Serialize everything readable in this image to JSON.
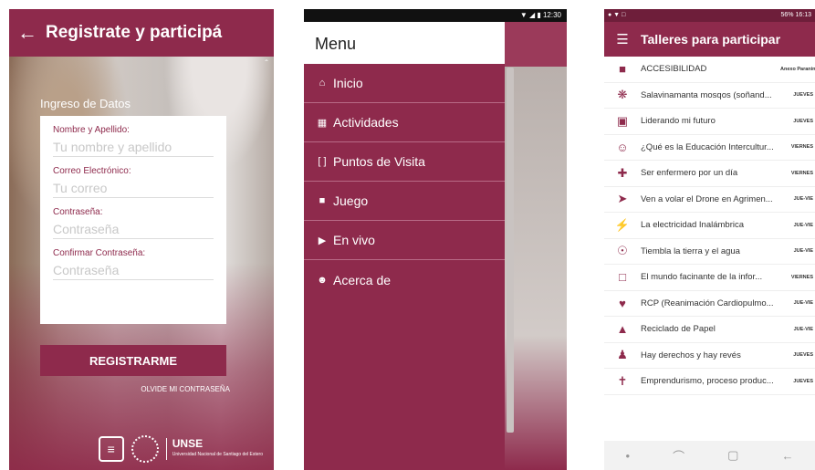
{
  "screen1": {
    "back_icon": "arrow-left-icon",
    "title": "Registrate y participá",
    "section_title": "Ingreso de Datos",
    "fields": [
      {
        "label": "Nombre y Apellido:",
        "placeholder": "Tu nombre y apellido"
      },
      {
        "label": "Correo Electrónico:",
        "placeholder": "Tu correo"
      },
      {
        "label": "Contraseña:",
        "placeholder": "Contraseña"
      },
      {
        "label": "Confirmar Contraseña:",
        "placeholder": "Contraseña"
      }
    ],
    "register_button": "REGISTRARME",
    "forgot_link": "OLVIDE MI CONTRASEÑA",
    "logos": {
      "unse": "UNSE",
      "unse_sub": "Universidad Nacional de Santiago del Estero"
    }
  },
  "screen2": {
    "status_time": "12:30",
    "menu_title": "Menu",
    "items": [
      {
        "label": "Inicio",
        "icon": "home-icon"
      },
      {
        "label": "Actividades",
        "icon": "calendar-icon"
      },
      {
        "label": "Puntos de Visita",
        "icon": "qr-scan-icon"
      },
      {
        "label": "Juego",
        "icon": "gamepad-icon"
      },
      {
        "label": "En vivo",
        "icon": "video-camera-icon"
      },
      {
        "label": "Acerca de",
        "icon": "group-icon"
      }
    ]
  },
  "screen3": {
    "status_right": "56% 16:13",
    "title": "Talleres para participar",
    "menu_icon": "hamburger-icon",
    "items": [
      {
        "name": "ACCESIBILIDAD",
        "day": "Anexo Paraninfo",
        "icon": "video-camera-icon"
      },
      {
        "name": "Salavinamanta mosqos (soñand...",
        "day": "JUEVES",
        "icon": "cog-circle-icon"
      },
      {
        "name": "Liderando mi futuro",
        "day": "JUEVES",
        "icon": "briefcase-icon"
      },
      {
        "name": "¿Qué es la Educación Intercultur...",
        "day": "VIERNES",
        "icon": "smile-icon"
      },
      {
        "name": "Ser enfermero por un día",
        "day": "VIERNES",
        "icon": "medkit-icon"
      },
      {
        "name": "Ven a volar el Drone en Agrimen...",
        "day": "JUE-VIE",
        "icon": "paper-plane-icon"
      },
      {
        "name": "La electricidad Inalámbrica",
        "day": "JUE-VIE",
        "icon": "lightning-icon"
      },
      {
        "name": "Tiembla la tierra y el agua",
        "day": "JUE-VIE",
        "icon": "globe-icon"
      },
      {
        "name": "El mundo facinante de la infor...",
        "day": "VIERNES",
        "icon": "monitor-icon"
      },
      {
        "name": "RCP (Reanimación Cardiopulmo...",
        "day": "JUE-VIE",
        "icon": "heart-icon"
      },
      {
        "name": "Reciclado de Papel",
        "day": "JUE-VIE",
        "icon": "thumbs-up-icon"
      },
      {
        "name": "Hay derechos y hay revés",
        "day": "JUEVES",
        "icon": "person-icon"
      },
      {
        "name": "Emprendurismo, proceso produc...",
        "day": "JUEVES",
        "icon": "accessibility-icon"
      }
    ]
  },
  "colors": {
    "brand": "#8e2a4c",
    "white": "#ffffff"
  }
}
